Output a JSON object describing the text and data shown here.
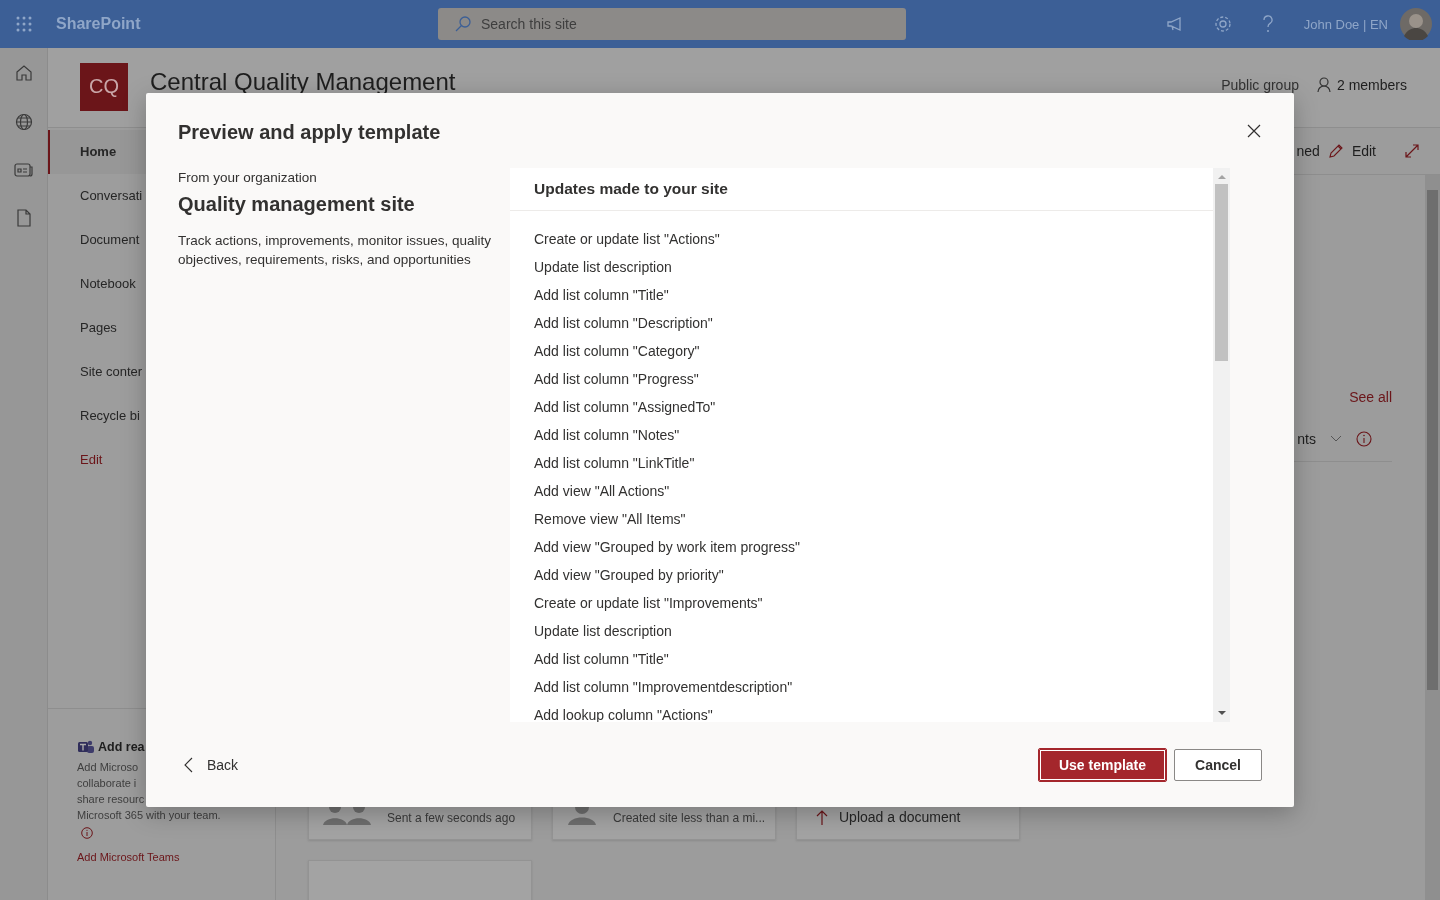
{
  "top_bar": {
    "app_name": "SharePoint",
    "search": {
      "placeholder": "Search this site"
    },
    "user": "John Doe | EN"
  },
  "site": {
    "logo": "CQ",
    "title": "Central Quality Management",
    "privacy": "Public group",
    "members": "2 members"
  },
  "nav": {
    "items": [
      {
        "label": "Home",
        "selected": true
      },
      {
        "label": "Conversati",
        "selected": false
      },
      {
        "label": "Document",
        "selected": false
      },
      {
        "label": "Notebook",
        "selected": false
      },
      {
        "label": "Pages",
        "selected": false
      },
      {
        "label": "Site conter",
        "selected": false
      },
      {
        "label": "Recycle bi",
        "selected": false
      }
    ],
    "edit_link": "Edit"
  },
  "teams_panel": {
    "title": "Add rea",
    "lines": [
      "Add Microso",
      "collaborate i",
      "share resourc",
      "Microsoft 365 with your team."
    ],
    "link": "Add Microsoft Teams"
  },
  "command_bar": {
    "status_fragment": "ned",
    "edit": "Edit"
  },
  "web_part": {
    "see_all": "See all",
    "filter": "nts"
  },
  "activity_cards": [
    {
      "kind": "people",
      "text": "Sent a few seconds ago"
    },
    {
      "kind": "person",
      "text": "Created site less than a mi..."
    },
    {
      "kind": "upload",
      "text": "Upload a document"
    },
    {
      "kind": "empty"
    }
  ],
  "dialog": {
    "title": "Preview and apply template",
    "source": "From your organization",
    "template_name": "Quality management site",
    "description": "Track actions, improvements, monitor issues, quality objectives, requirements, risks, and opportunities",
    "updates_heading": "Updates made to your site",
    "updates": [
      "Create or update list \"Actions\"",
      "Update list description",
      "Add list column \"Title\"",
      "Add list column \"Description\"",
      "Add list column \"Category\"",
      "Add list column \"Progress\"",
      "Add list column \"AssignedTo\"",
      "Add list column \"Notes\"",
      "Add list column \"LinkTitle\"",
      "Add view \"All Actions\"",
      "Remove view \"All Items\"",
      "Add view \"Grouped by work item progress\"",
      "Add view \"Grouped by priority\"",
      "Create or update list \"Improvements\"",
      "Update list description",
      "Add list column \"Title\"",
      "Add list column \"Improvementdescription\"",
      "Add lookup column \"Actions\""
    ],
    "back": "Back",
    "primary_button": "Use template",
    "cancel_button": "Cancel"
  }
}
